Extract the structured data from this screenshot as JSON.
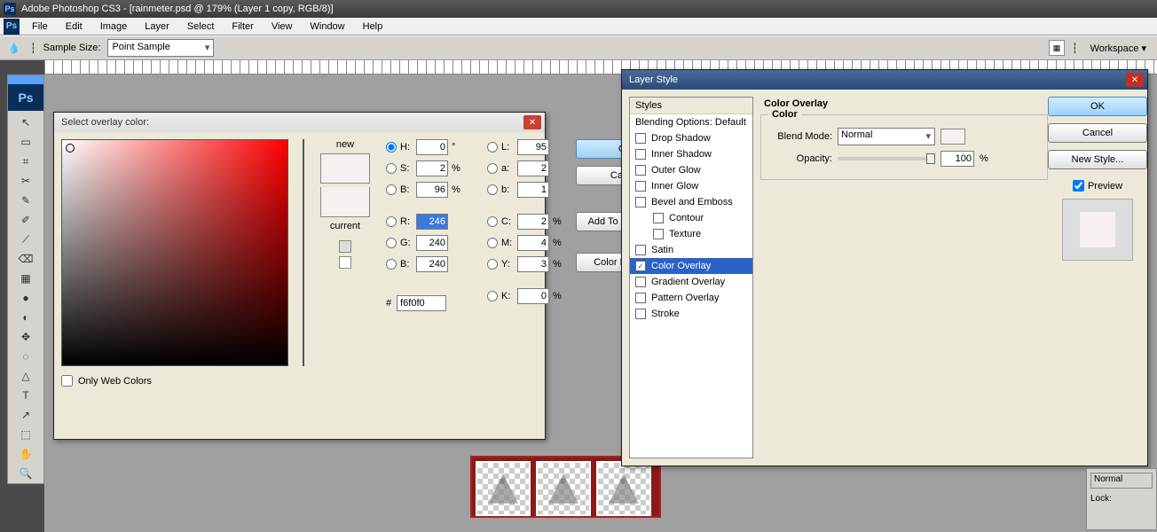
{
  "app": {
    "title": "Adobe Photoshop CS3 - [rainmeter.psd @ 179% (Layer 1 copy, RGB/8)]",
    "ps_short": "Ps"
  },
  "menu": [
    "File",
    "Edit",
    "Image",
    "Layer",
    "Select",
    "Filter",
    "View",
    "Window",
    "Help"
  ],
  "options": {
    "sample_label": "Sample Size:",
    "sample_value": "Point Sample",
    "workspace_label": "Workspace ▾"
  },
  "tools_big": "Ps",
  "tools": [
    "↖",
    "▭",
    "⌗",
    "✂",
    "✎",
    "✐",
    "⟋",
    "⌫",
    "▦",
    "●",
    "◐",
    "✥",
    "◌",
    "△",
    "T",
    "↗",
    "⬚",
    "✋",
    "🔍"
  ],
  "colorpicker": {
    "title": "Select overlay color:",
    "new_label": "new",
    "current_label": "current",
    "ok": "OK",
    "cancel": "Cancel",
    "add_swatches": "Add To Swatches",
    "color_libraries": "Color Libraries",
    "fields_left": [
      {
        "k": "H",
        "v": "0",
        "u": "°",
        "sel": true
      },
      {
        "k": "S",
        "v": "2",
        "u": "%"
      },
      {
        "k": "B",
        "v": "96",
        "u": "%"
      },
      {
        "k": "R",
        "v": "246",
        "hl": true
      },
      {
        "k": "G",
        "v": "240"
      },
      {
        "k": "B",
        "v": "240"
      }
    ],
    "fields_right": [
      {
        "k": "L",
        "v": "95"
      },
      {
        "k": "a",
        "v": "2"
      },
      {
        "k": "b",
        "v": "1"
      },
      {
        "k": "C",
        "v": "2",
        "u": "%"
      },
      {
        "k": "M",
        "v": "4",
        "u": "%"
      },
      {
        "k": "Y",
        "v": "3",
        "u": "%"
      },
      {
        "k": "K",
        "v": "0",
        "u": "%"
      }
    ],
    "hex_label": "#",
    "hex_value": "f6f0f0",
    "owc": "Only Web Colors"
  },
  "layerstyle": {
    "title": "Layer Style",
    "styles_hdr": "Styles",
    "blend_opts": "Blending Options: Default",
    "items": [
      {
        "label": "Drop Shadow",
        "checked": false
      },
      {
        "label": "Inner Shadow",
        "checked": false
      },
      {
        "label": "Outer Glow",
        "checked": false
      },
      {
        "label": "Inner Glow",
        "checked": false
      },
      {
        "label": "Bevel and Emboss",
        "checked": false
      },
      {
        "label": "Contour",
        "checked": false,
        "indent": true
      },
      {
        "label": "Texture",
        "checked": false,
        "indent": true
      },
      {
        "label": "Satin",
        "checked": false
      },
      {
        "label": "Color Overlay",
        "checked": true,
        "selected": true
      },
      {
        "label": "Gradient Overlay",
        "checked": false
      },
      {
        "label": "Pattern Overlay",
        "checked": false
      },
      {
        "label": "Stroke",
        "checked": false
      }
    ],
    "section_title": "Color Overlay",
    "group_title": "Color",
    "blend_mode_label": "Blend Mode:",
    "blend_mode_value": "Normal",
    "opacity_label": "Opacity:",
    "opacity_value": "100",
    "opacity_unit": "%",
    "ok": "OK",
    "cancel": "Cancel",
    "newstyle": "New Style...",
    "preview": "Preview"
  },
  "rightdock": {
    "mode": "Normal",
    "lock": "Lock:"
  }
}
